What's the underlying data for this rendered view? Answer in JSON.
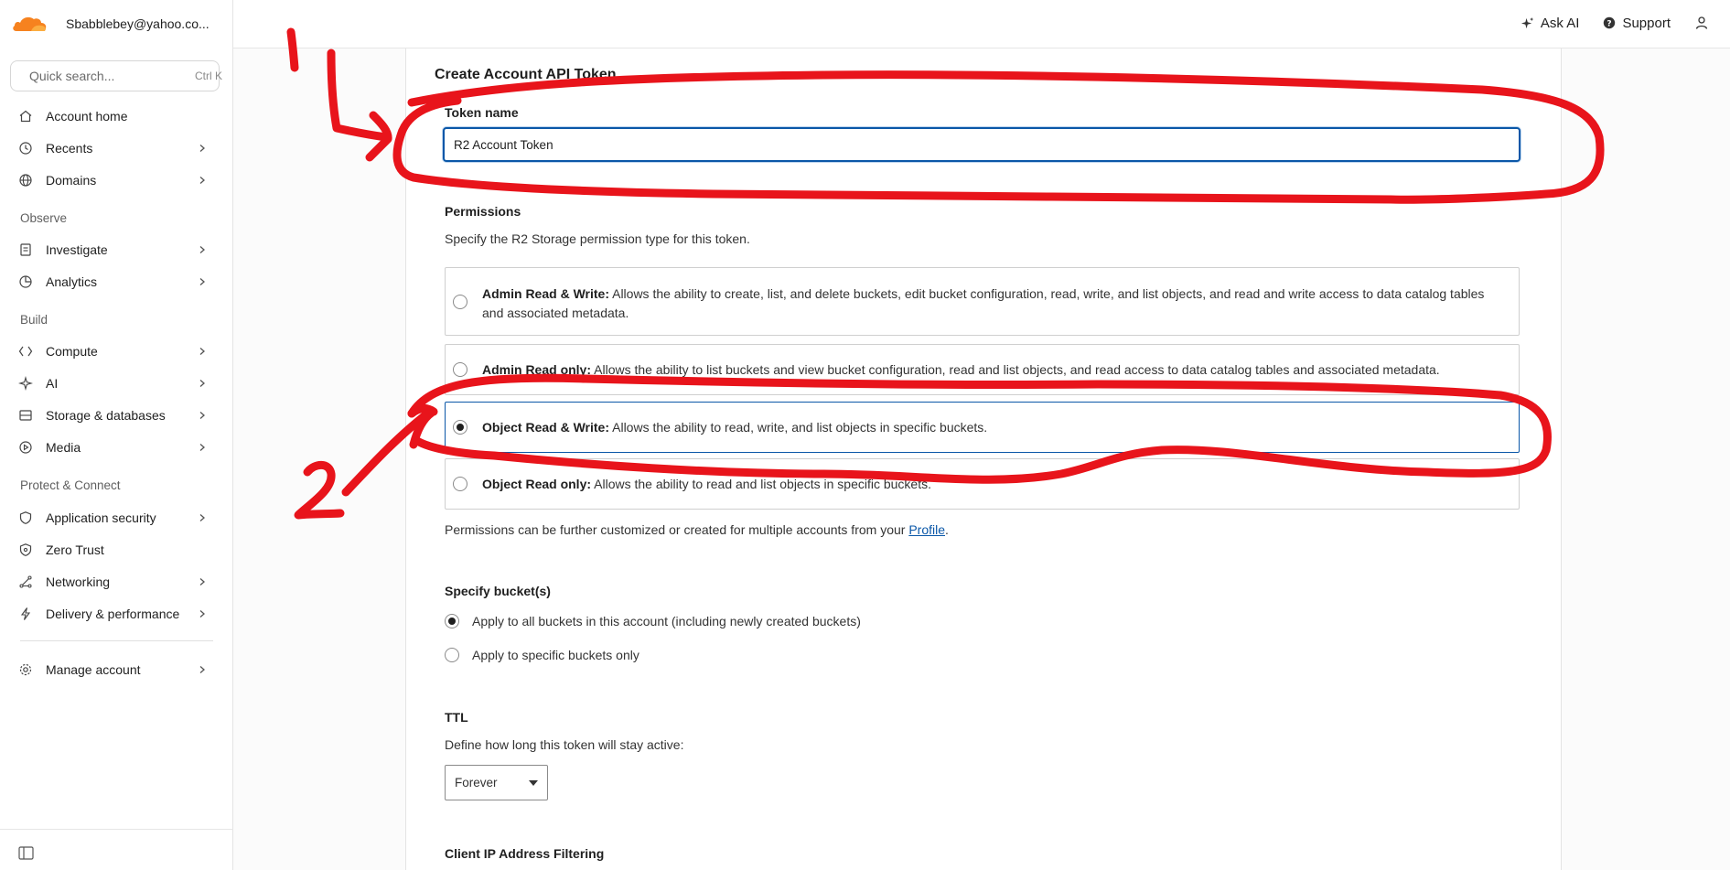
{
  "account": {
    "email": "Sbabblebey@yahoo.co...",
    "brand_color": "#f6821f"
  },
  "search": {
    "placeholder": "Quick search...",
    "shortcut": "Ctrl K"
  },
  "sidebar": {
    "items": [
      {
        "label": "Account home",
        "icon": "home-icon",
        "chevron": false
      },
      {
        "label": "Recents",
        "icon": "clock-icon",
        "chevron": true
      },
      {
        "label": "Domains",
        "icon": "globe-icon",
        "chevron": true
      },
      {
        "label": "Investigate",
        "icon": "document-icon",
        "chevron": true
      },
      {
        "label": "Analytics",
        "icon": "pie-chart-icon",
        "chevron": true
      },
      {
        "label": "Compute",
        "icon": "compute-icon",
        "chevron": true
      },
      {
        "label": "AI",
        "icon": "sparkle-icon",
        "chevron": true
      },
      {
        "label": "Storage & databases",
        "icon": "storage-icon",
        "chevron": true
      },
      {
        "label": "Media",
        "icon": "play-icon",
        "chevron": true
      },
      {
        "label": "Application security",
        "icon": "shield-icon",
        "chevron": true
      },
      {
        "label": "Zero Trust",
        "icon": "shield-lock-icon",
        "chevron": false
      },
      {
        "label": "Networking",
        "icon": "network-icon",
        "chevron": true
      },
      {
        "label": "Delivery & performance",
        "icon": "bolt-icon",
        "chevron": true
      },
      {
        "label": "Manage account",
        "icon": "gear-icon",
        "chevron": true
      }
    ],
    "sections": {
      "observe": "Observe",
      "build": "Build",
      "protect": "Protect & Connect"
    }
  },
  "topbar": {
    "ask_ai": "Ask AI",
    "support": "Support"
  },
  "main": {
    "title": "Create Account API Token",
    "token_name_label": "Token name",
    "token_name_value": "R2 Account Token",
    "permissions_label": "Permissions",
    "permissions_help": "Specify the R2 Storage permission type for this token.",
    "options": [
      {
        "name": "Admin Read & Write:",
        "desc": " Allows the ability to create, list, and delete buckets, edit bucket configuration, read, write, and list objects, and read and write access to data catalog tables and associated metadata.",
        "selected": false
      },
      {
        "name": "Admin Read only:",
        "desc": " Allows the ability to list buckets and view bucket configuration, read and list objects, and read access to data catalog tables and associated metadata.",
        "selected": false
      },
      {
        "name": "Object Read & Write:",
        "desc": " Allows the ability to read, write, and list objects in specific buckets.",
        "selected": true
      },
      {
        "name": "Object Read only:",
        "desc": " Allows the ability to read and list objects in specific buckets.",
        "selected": false
      }
    ],
    "permissions_note_prefix": "Permissions can be further customized or created for multiple accounts from your ",
    "permissions_note_link": "Profile",
    "permissions_note_suffix": ".",
    "buckets_label": "Specify bucket(s)",
    "bucket_options": [
      {
        "label": "Apply to all buckets in this account (including newly created buckets)",
        "selected": true
      },
      {
        "label": "Apply to specific buckets only",
        "selected": false
      }
    ],
    "ttl_label": "TTL",
    "ttl_help": "Define how long this token will stay active:",
    "ttl_value": "Forever",
    "ip_filter_label": "Client IP Address Filtering"
  },
  "annotations": {
    "color": "#e8141b",
    "marks": [
      "1",
      "2"
    ]
  }
}
